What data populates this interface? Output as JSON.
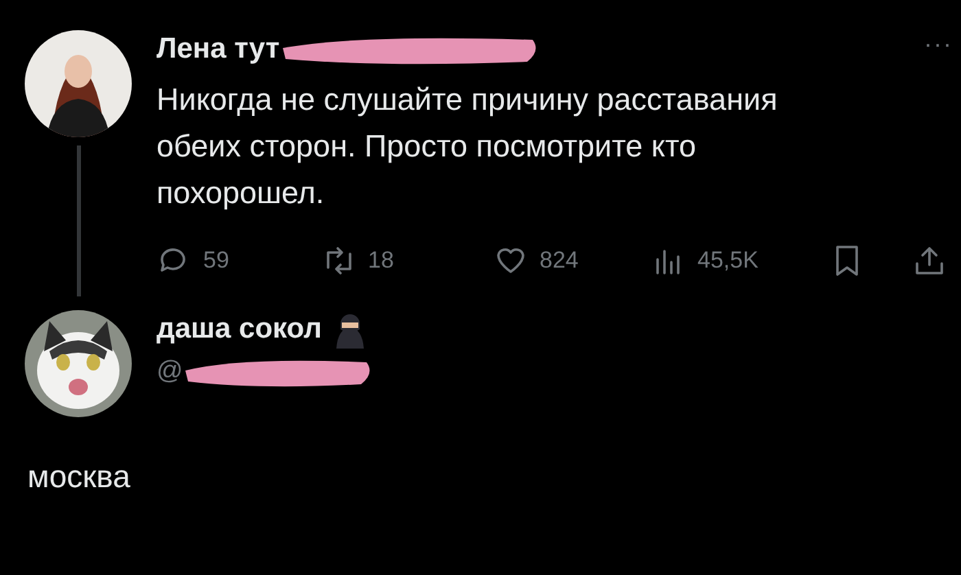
{
  "tweet": {
    "author": {
      "name": "Лена тут",
      "avatar": {
        "kind": "person"
      }
    },
    "more": "···",
    "text": "Никогда не слушайте причину расставания обеих сторон. Просто посмотрите кто похорошел.",
    "actions": [
      {
        "kind": "reply",
        "count": "59"
      },
      {
        "kind": "retweet",
        "count": "18"
      },
      {
        "kind": "like",
        "count": "824"
      },
      {
        "kind": "views",
        "count": "45,5K"
      },
      {
        "kind": "bookmark"
      },
      {
        "kind": "share"
      }
    ]
  },
  "reply": {
    "author": {
      "name": "даша сокол",
      "handle": "@"
    },
    "text": "москва"
  }
}
